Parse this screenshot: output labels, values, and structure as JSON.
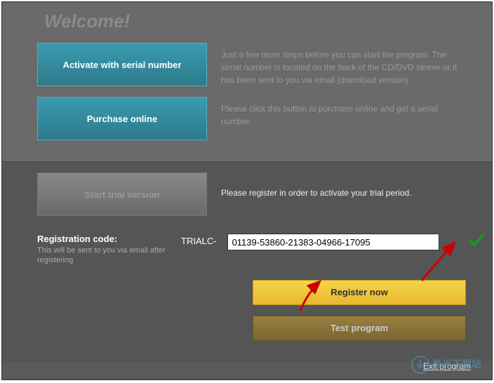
{
  "header": {
    "welcome": "Welcome!"
  },
  "options": {
    "activate": {
      "label": "Activate with serial number",
      "desc": "Just a few more steps before you can start the program. The serial number is located on the back of the CD/DVD sleeve or it has been sent to you via email (download version)."
    },
    "purchase": {
      "label": "Purchase online",
      "desc": "Please click this button to purchase online and get a serial number."
    },
    "trial": {
      "label": "Start trial version",
      "desc": "Please register in order to activate your trial period."
    }
  },
  "registration": {
    "label": "Registration code:",
    "sublabel": "This will be sent to you via email after registering",
    "prefix": "TRIALC-",
    "value": "01139-53860-21383-04966-17095"
  },
  "actions": {
    "register": "Register now",
    "test": "Test program",
    "exit": "Exit program"
  },
  "watermark": "极光下载站",
  "colors": {
    "teal": "#3a9bb0",
    "yellow": "#f5d547",
    "arrow": "#cc0000",
    "check": "#00aa00"
  }
}
